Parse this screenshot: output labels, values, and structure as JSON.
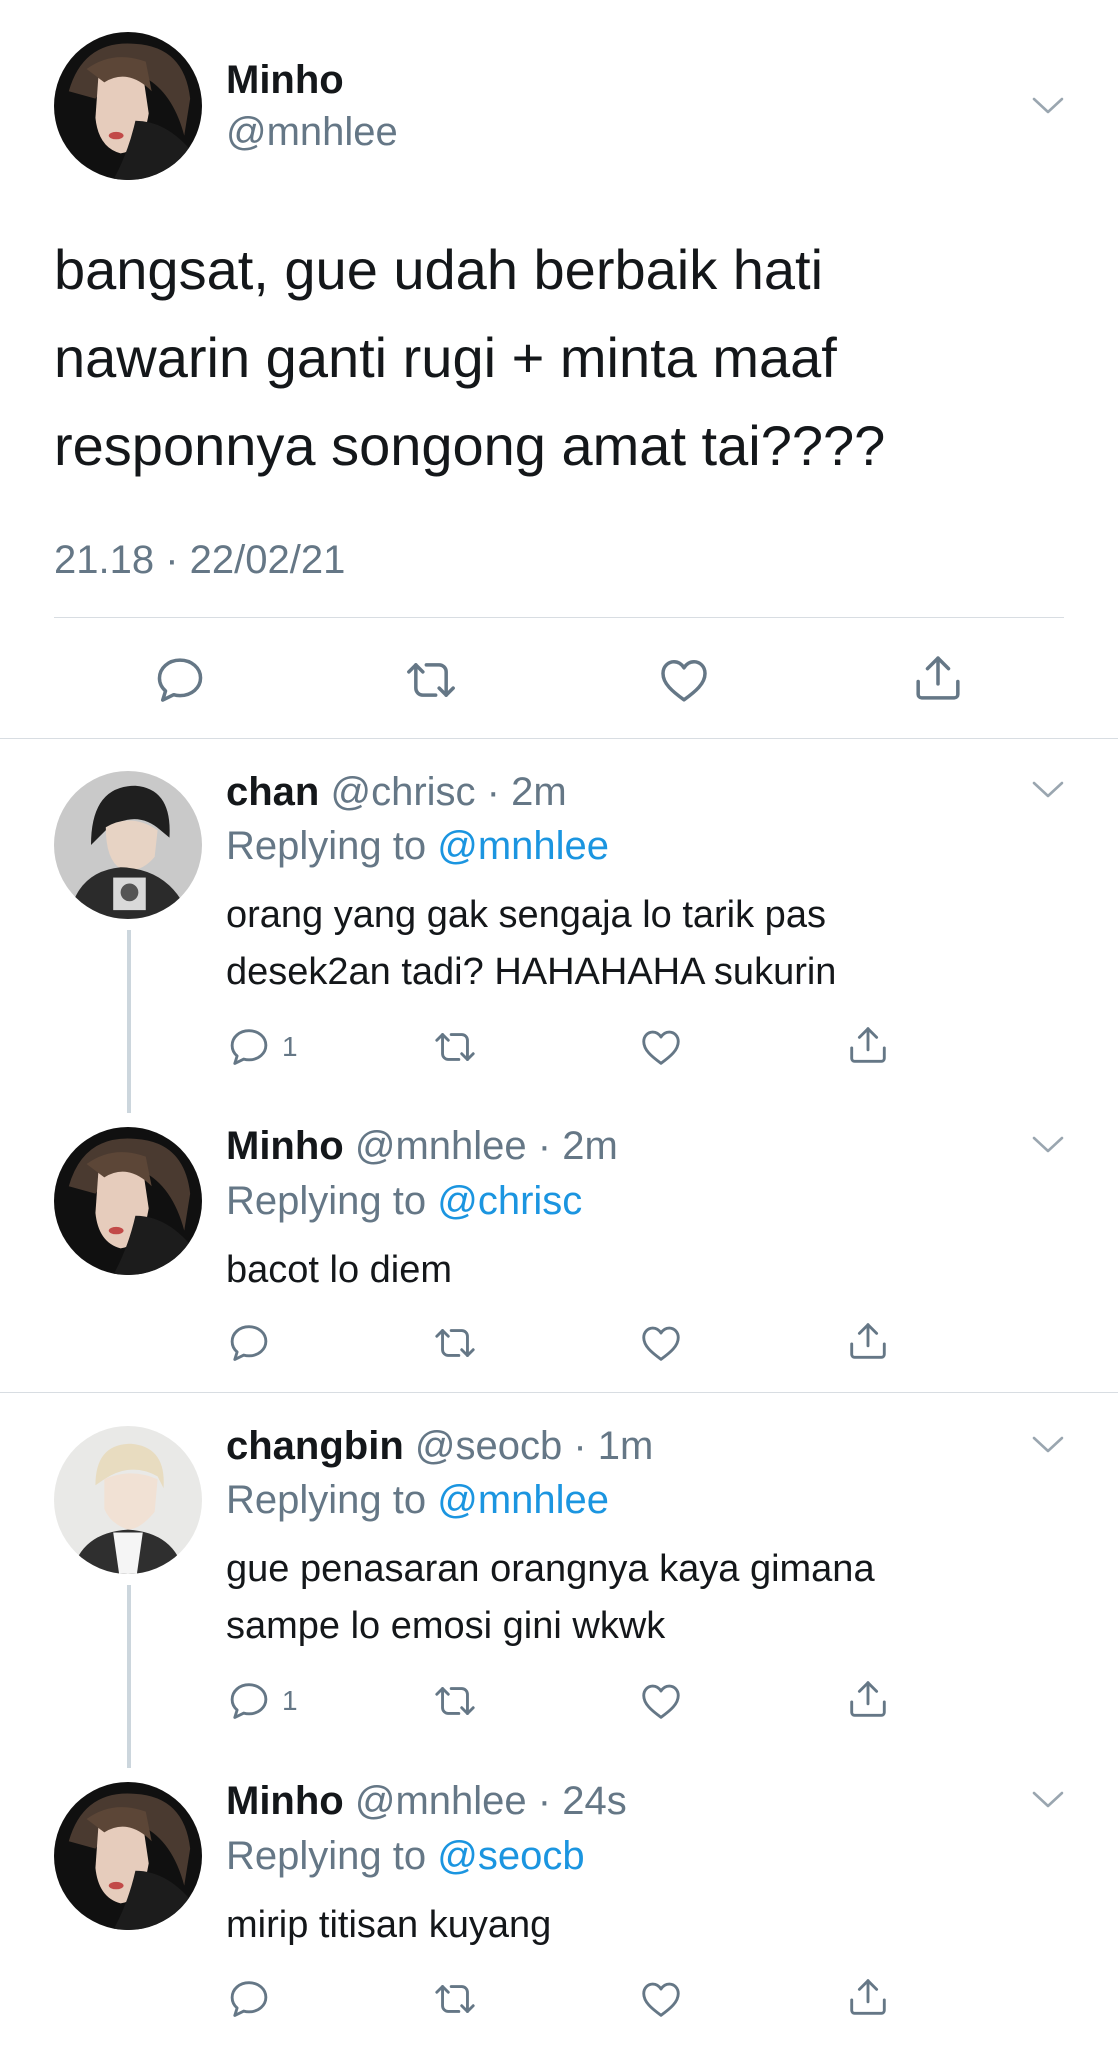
{
  "main_tweet": {
    "author_name": "Minho",
    "author_handle": "@mnhlee",
    "text_lines": [
      "bangsat, gue udah berbaik hati",
      "nawarin ganti rugi + minta maaf",
      "responnya songong amat tai????"
    ],
    "timestamp": "21.18 · 22/02/21"
  },
  "replies": [
    {
      "name": "chan",
      "handle": "@chrisc",
      "time": "· 2m",
      "replying_label": "Replying to",
      "replying_to": "@mnhlee",
      "text_lines": [
        "orang yang gak sengaja lo tarik pas",
        "desek2an tadi? HAHAHAHA sukurin"
      ],
      "reply_count": "1"
    },
    {
      "name": "Minho",
      "handle": "@mnhlee",
      "time": "· 2m",
      "replying_label": "Replying to",
      "replying_to": "@chrisc",
      "text_lines": [
        "bacot lo diem"
      ],
      "reply_count": ""
    },
    {
      "name": "changbin",
      "handle": "@seocb",
      "time": "· 1m",
      "replying_label": "Replying to",
      "replying_to": "@mnhlee",
      "text_lines": [
        "gue penasaran orangnya kaya gimana",
        "sampe lo emosi gini wkwk"
      ],
      "reply_count": "1"
    },
    {
      "name": "Minho",
      "handle": "@mnhlee",
      "time": "· 24s",
      "replying_label": "Replying to",
      "replying_to": "@seocb",
      "text_lines": [
        "mirip titisan kuyang"
      ],
      "reply_count": ""
    }
  ],
  "icons": [
    "chevron-down-icon",
    "reply-icon",
    "retweet-icon",
    "like-icon",
    "share-icon"
  ],
  "colors": {
    "text": "#14171a",
    "muted": "#657786",
    "link": "#1b95e0",
    "divider": "#d8dde2",
    "thread_line": "#ccd6dd"
  }
}
